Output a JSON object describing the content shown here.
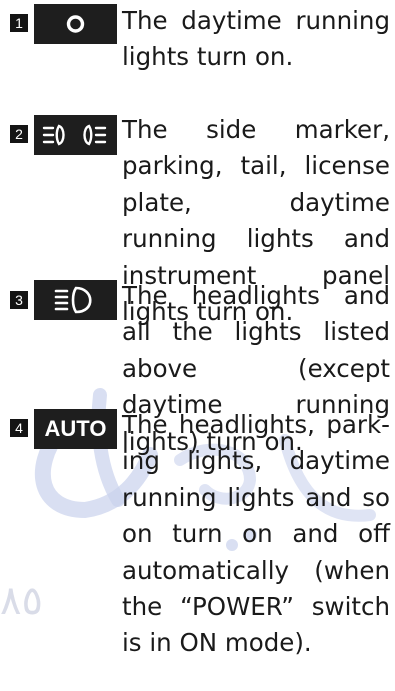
{
  "items": [
    {
      "number": "1",
      "icon": "daytime-running-light-icon",
      "text": "The daytime running lights turn on."
    },
    {
      "number": "2",
      "icon": "side-marker-light-icon",
      "text": "The side marker, park­ing, tail, license plate, daytime running lights and instrument panel lights turn on."
    },
    {
      "number": "3",
      "icon": "headlight-icon",
      "text": "The headlights and all the lights listed above (except daytime run­ning lights) turn on."
    },
    {
      "number": "4",
      "icon": "auto-light-icon",
      "icon_label": "AUTO",
      "text": "The headlights, park­ing lights, daytime running lights and so on turn on and off automatically (when the “POWER” switch is in ON mode)."
    }
  ],
  "watermark": {
    "number": "٨٥"
  },
  "colors": {
    "badge": "#141414",
    "icon_bg": "#1e1e1e",
    "text": "#1a1a1a",
    "watermark": "#b7c2e2"
  }
}
